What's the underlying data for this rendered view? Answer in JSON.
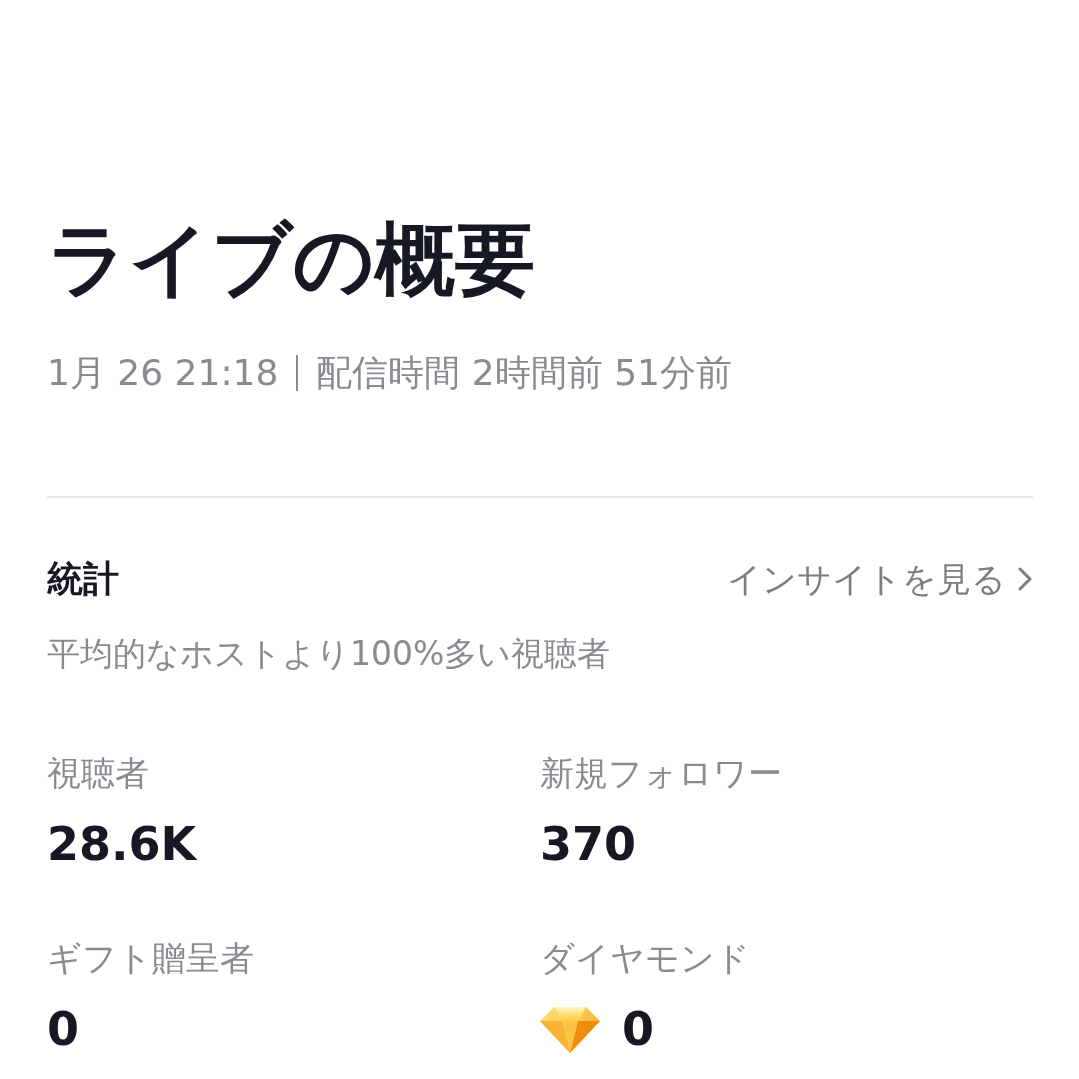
{
  "header": {
    "title": "ライブの概要",
    "date": "1月 26 21:18",
    "duration": "配信時間 2時間前 51分前"
  },
  "stats": {
    "heading": "統計",
    "insights_link": "インサイトを見る",
    "comparison": "平均的なホストより100%多い視聴者",
    "metrics": [
      {
        "label": "視聴者",
        "value": "28.6K",
        "kind": "plain"
      },
      {
        "label": "新規フォロワー",
        "value": "370",
        "kind": "plain"
      },
      {
        "label": "ギフト贈呈者",
        "value": "0",
        "kind": "plain"
      },
      {
        "label": "ダイヤモンド",
        "value": "0",
        "kind": "diamond"
      }
    ]
  }
}
